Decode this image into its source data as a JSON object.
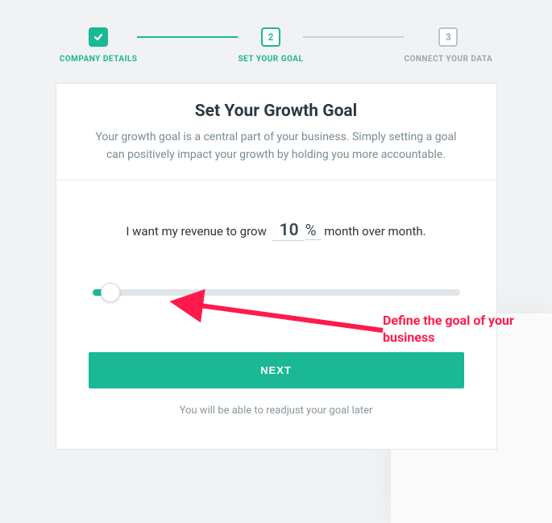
{
  "stepper": {
    "steps": [
      {
        "num": "",
        "label": "COMPANY DETAILS"
      },
      {
        "num": "2",
        "label": "SET YOUR GOAL"
      },
      {
        "num": "3",
        "label": "CONNECT YOUR DATA"
      }
    ]
  },
  "card": {
    "title": "Set Your Growth Goal",
    "subtitle": "Your growth goal is a central part of your business. Simply setting a goal can positively impact your growth by holding you more accountable.",
    "goal_prefix": "I want my revenue to grow",
    "goal_value": "10",
    "goal_unit": "%",
    "goal_suffix": "month over month.",
    "next_label": "NEXT",
    "footnote": "You will be able to readjust your goal later"
  },
  "annotation": "Define the goal of your business",
  "colors": {
    "accent": "#1ab894",
    "anno": "#ff1a4b"
  }
}
